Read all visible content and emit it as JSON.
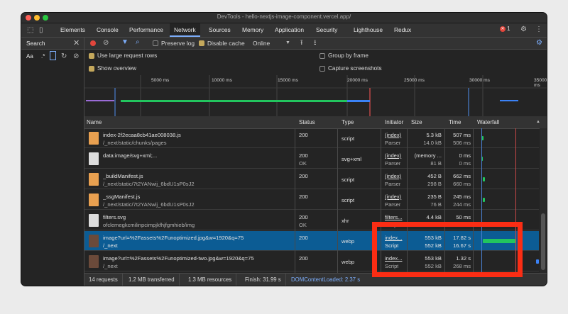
{
  "window": {
    "title": "DevTools - hello-nextjs-image-component.vercel.app/"
  },
  "tabs": [
    "Elements",
    "Console",
    "Performance",
    "Network",
    "Sources",
    "Memory",
    "Application",
    "Security",
    "Lighthouse",
    "Redux"
  ],
  "active_tab": "Network",
  "error_count": "1",
  "search_panel": {
    "title": "Search",
    "aa": "Aa",
    "regex": ".*"
  },
  "toolbar": {
    "preserve_log": "Preserve log",
    "disable_cache": "Disable cache",
    "throttle": "Online"
  },
  "options": {
    "large_rows": "Use large request rows",
    "show_overview": "Show overview",
    "group_by_frame": "Group by frame",
    "capture_screenshots": "Capture screenshots"
  },
  "overview_ticks": [
    "5000 ms",
    "10000 ms",
    "15000 ms",
    "20000 ms",
    "25000 ms",
    "30000 ms",
    "35000 ms"
  ],
  "columns": [
    "Name",
    "Status",
    "Type",
    "Initiator",
    "Size",
    "Time",
    "Waterfall"
  ],
  "rows": [
    {
      "name": "index-2f2ecaa8cb41ae008038.js",
      "path": "/_next/static/chunks/pages",
      "status": "200",
      "status2": "",
      "type": "script",
      "initiator": "(index)",
      "initiator2": "Parser",
      "size": "5.3 kB",
      "size2": "14.0 kB",
      "time": "507 ms",
      "time2": "506 ms"
    },
    {
      "name": "data:image/svg+xml;...",
      "path": "",
      "status": "200",
      "status2": "OK",
      "type": "svg+xml",
      "initiator": "(index)",
      "initiator2": "Parser",
      "size": "(memory ...",
      "size2": "81 B",
      "time": "0 ms",
      "time2": "0 ms"
    },
    {
      "name": "_buildManifest.js",
      "path": "/_next/static/7t2YANwij_6bdU1sP0sJ2",
      "status": "200",
      "status2": "",
      "type": "script",
      "initiator": "(index)",
      "initiator2": "Parser",
      "size": "452 B",
      "size2": "298 B",
      "time": "662 ms",
      "time2": "660 ms"
    },
    {
      "name": "_ssgManifest.js",
      "path": "/_next/static/7t2YANwij_6bdU1sP0sJ2",
      "status": "200",
      "status2": "",
      "type": "script",
      "initiator": "(index)",
      "initiator2": "Parser",
      "size": "235 B",
      "size2": "76 B",
      "time": "245 ms",
      "time2": "244 ms"
    },
    {
      "name": "filters.svg",
      "path": "ofclemegkcmilinpcimpjkfhjfgmhieb/img",
      "status": "200",
      "status2": "OK",
      "type": "xhr",
      "initiator": "filters...",
      "initiator2": "Script",
      "size": "4.4 kB",
      "size2": "4.4 kB",
      "time": "50 ms",
      "time2": "49 ms"
    },
    {
      "name": "image?url=%2Fassets%2Funoptimized.jpg&w=1920&q=75",
      "path": "/_next",
      "status": "200",
      "status2": "",
      "type": "webp",
      "initiator": "index...",
      "initiator2": "Script",
      "size": "553 kB",
      "size2": "552 kB",
      "time": "17.82 s",
      "time2": "16.67 s"
    },
    {
      "name": "image?url=%2Fassets%2Funoptimized-two.jpg&w=1920&q=75",
      "path": "/_next",
      "status": "200",
      "status2": "",
      "type": "webp",
      "initiator": "index...",
      "initiator2": "Script",
      "size": "553 kB",
      "size2": "552 kB",
      "time": "1.32 s",
      "time2": "268 ms"
    }
  ],
  "selected_row": 5,
  "status_bar": {
    "requests": "14 requests",
    "transferred": "1.2 MB transferred",
    "resources": "1.3 MB resources",
    "finish": "Finish: 31.99 s",
    "dcl": "DOMContentLoaded: 2.37 s"
  },
  "colors": {
    "accent": "#7cacf8",
    "selected_row": "#0c5c94",
    "highlight_box": "#fb2d14",
    "waterfall_bar": "#22c55e"
  }
}
